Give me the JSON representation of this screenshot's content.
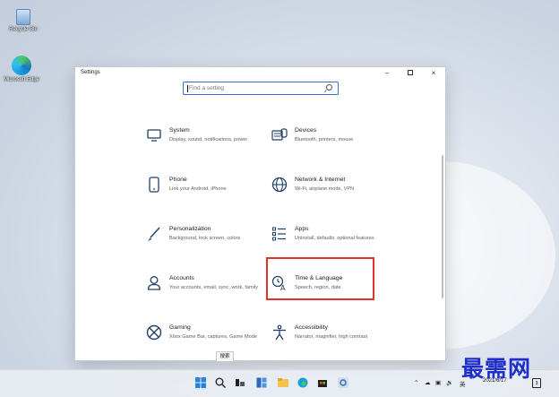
{
  "desktop": {
    "recycle_bin": "Recycle Bin",
    "edge": "Microsoft Edge"
  },
  "window": {
    "title": "Settings",
    "controls": {
      "minimize": "–",
      "maximize": "",
      "close": "×"
    }
  },
  "search": {
    "placeholder": "Find a setting"
  },
  "tiles": [
    {
      "name": "System",
      "desc": "Display, sound, notifications, power",
      "icon": "monitor-icon"
    },
    {
      "name": "Devices",
      "desc": "Bluetooth, printers, mouse",
      "icon": "keyboard-icon"
    },
    {
      "name": "Phone",
      "desc": "Link your Android, iPhone",
      "icon": "phone-icon"
    },
    {
      "name": "Network & Internet",
      "desc": "Wi-Fi, airplane mode, VPN",
      "icon": "globe-icon"
    },
    {
      "name": "Personalization",
      "desc": "Background, lock screen, colors",
      "icon": "brush-icon"
    },
    {
      "name": "Apps",
      "desc": "Uninstall, defaults, optional features",
      "icon": "apps-list-icon"
    },
    {
      "name": "Accounts",
      "desc": "Your accounts, email, sync, work, family",
      "icon": "person-icon"
    },
    {
      "name": "Time & Language",
      "desc": "Speech, region, date",
      "icon": "time-language-icon"
    },
    {
      "name": "Gaming",
      "desc": "Xbox Game Bar, captures, Game Mode",
      "icon": "xbox-icon"
    },
    {
      "name": "Accessibility",
      "desc": "Narrator, magnifier, high contrast",
      "icon": "accessibility-icon"
    }
  ],
  "taskbar": {
    "tooltip": "搜索",
    "clock_time": "",
    "clock_date": "2021/6/17",
    "tray_text": "英",
    "notification_count": "3"
  },
  "watermark": "最需网",
  "colors": {
    "accent": "#2f6fd0",
    "highlight": "#e2312b"
  }
}
